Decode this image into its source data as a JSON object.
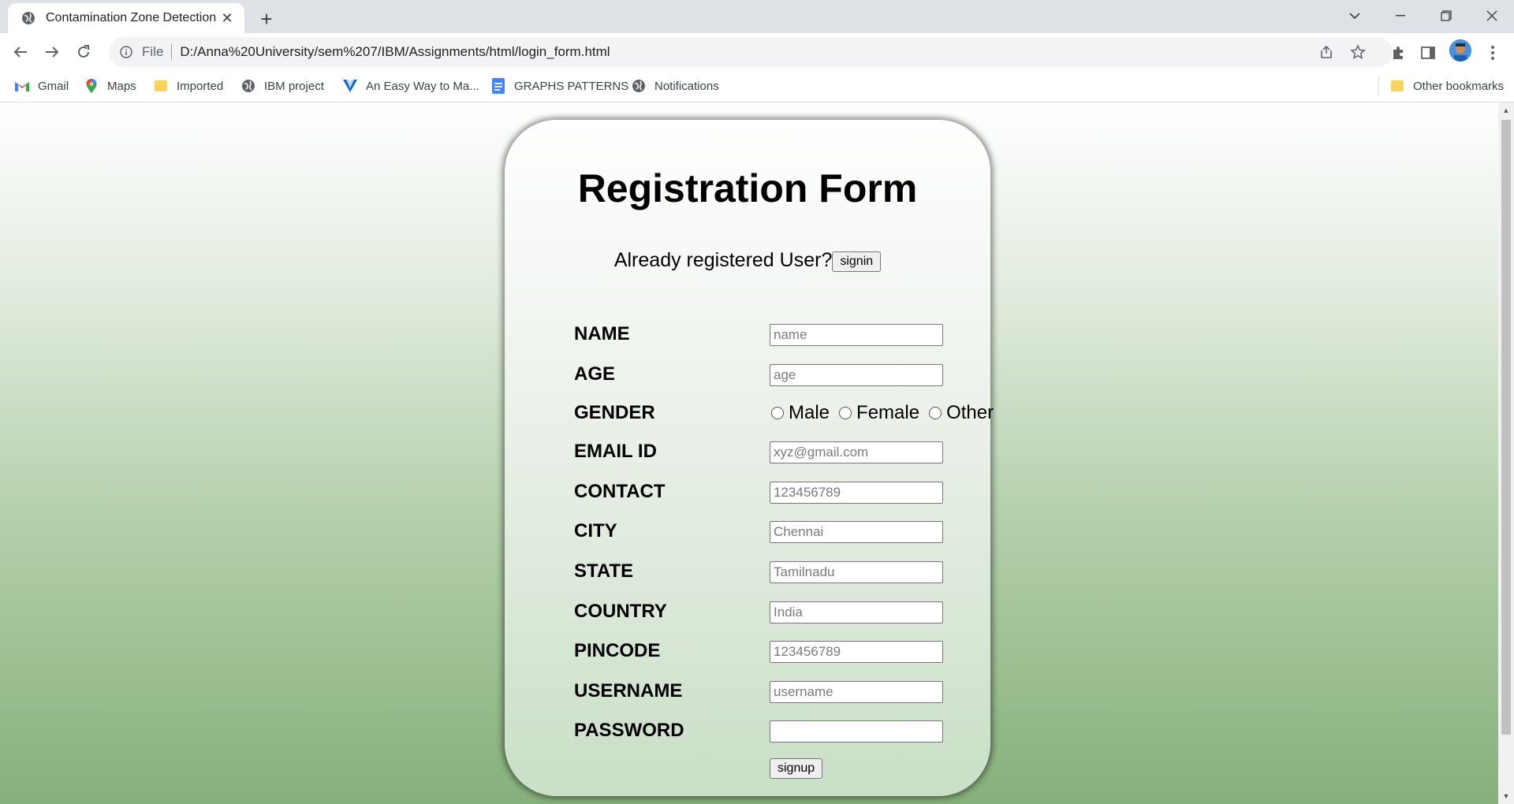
{
  "browser": {
    "tab_title": "Contamination Zone Detection",
    "new_tab_symbol": "+",
    "scheme": "File",
    "url": "D:/Anna%20University/sem%207/IBM/Assignments/html/login_form.html"
  },
  "bookmarks": {
    "items": [
      {
        "label": "Gmail",
        "icon": "gmail-icon"
      },
      {
        "label": "Maps",
        "icon": "maps-icon"
      },
      {
        "label": "Imported",
        "icon": "folder-icon"
      },
      {
        "label": "IBM project",
        "icon": "globe-icon"
      },
      {
        "label": "An Easy Way to Ma...",
        "icon": "vuetify-icon"
      },
      {
        "label": "GRAPHS PATTERNS",
        "icon": "docs-icon"
      },
      {
        "label": "Notifications",
        "icon": "globe-icon"
      }
    ],
    "other": "Other bookmarks"
  },
  "form": {
    "title": "Registration Form",
    "already": "Already registered User?",
    "signin_label": "signin",
    "fields": {
      "name": {
        "label": "NAME",
        "placeholder": "name"
      },
      "age": {
        "label": "AGE",
        "placeholder": "age"
      },
      "gender": {
        "label": "GENDER",
        "options": [
          "Male",
          "Female",
          "Other"
        ]
      },
      "email": {
        "label": "EMAIL ID",
        "placeholder": "xyz@gmail.com"
      },
      "contact": {
        "label": "CONTACT",
        "placeholder": "123456789"
      },
      "city": {
        "label": "CITY",
        "placeholder": "Chennai"
      },
      "state": {
        "label": "STATE",
        "placeholder": "Tamilnadu"
      },
      "country": {
        "label": "COUNTRY",
        "placeholder": "India"
      },
      "pincode": {
        "label": "PINCODE",
        "placeholder": "123456789"
      },
      "username": {
        "label": "USERNAME",
        "placeholder": "username"
      },
      "password": {
        "label": "PASSWORD",
        "placeholder": ""
      }
    },
    "signup_label": "signup"
  },
  "colors": {
    "bg_top": "#ffffff",
    "bg_bottom": "#86b07b",
    "card_bottom": "#c9dfc6"
  }
}
